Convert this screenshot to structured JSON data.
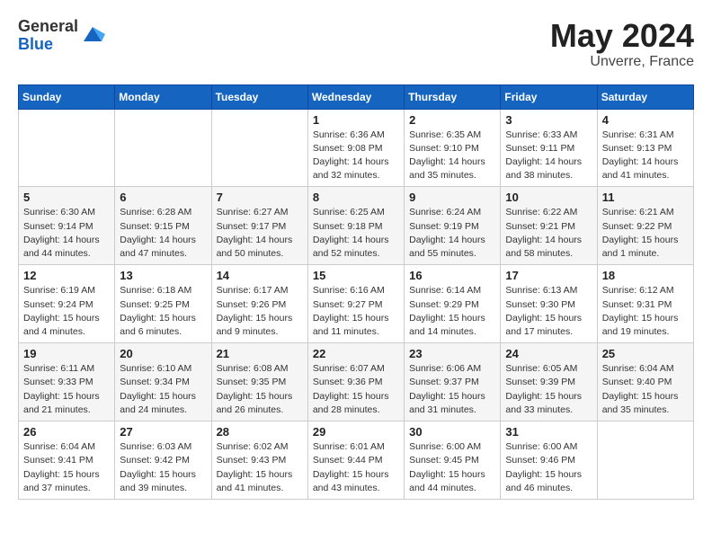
{
  "header": {
    "logo_general": "General",
    "logo_blue": "Blue",
    "month_year": "May 2024",
    "location": "Unverre, France"
  },
  "columns": [
    "Sunday",
    "Monday",
    "Tuesday",
    "Wednesday",
    "Thursday",
    "Friday",
    "Saturday"
  ],
  "weeks": [
    [
      {
        "day": "",
        "info": ""
      },
      {
        "day": "",
        "info": ""
      },
      {
        "day": "",
        "info": ""
      },
      {
        "day": "1",
        "info": "Sunrise: 6:36 AM\nSunset: 9:08 PM\nDaylight: 14 hours\nand 32 minutes."
      },
      {
        "day": "2",
        "info": "Sunrise: 6:35 AM\nSunset: 9:10 PM\nDaylight: 14 hours\nand 35 minutes."
      },
      {
        "day": "3",
        "info": "Sunrise: 6:33 AM\nSunset: 9:11 PM\nDaylight: 14 hours\nand 38 minutes."
      },
      {
        "day": "4",
        "info": "Sunrise: 6:31 AM\nSunset: 9:13 PM\nDaylight: 14 hours\nand 41 minutes."
      }
    ],
    [
      {
        "day": "5",
        "info": "Sunrise: 6:30 AM\nSunset: 9:14 PM\nDaylight: 14 hours\nand 44 minutes."
      },
      {
        "day": "6",
        "info": "Sunrise: 6:28 AM\nSunset: 9:15 PM\nDaylight: 14 hours\nand 47 minutes."
      },
      {
        "day": "7",
        "info": "Sunrise: 6:27 AM\nSunset: 9:17 PM\nDaylight: 14 hours\nand 50 minutes."
      },
      {
        "day": "8",
        "info": "Sunrise: 6:25 AM\nSunset: 9:18 PM\nDaylight: 14 hours\nand 52 minutes."
      },
      {
        "day": "9",
        "info": "Sunrise: 6:24 AM\nSunset: 9:19 PM\nDaylight: 14 hours\nand 55 minutes."
      },
      {
        "day": "10",
        "info": "Sunrise: 6:22 AM\nSunset: 9:21 PM\nDaylight: 14 hours\nand 58 minutes."
      },
      {
        "day": "11",
        "info": "Sunrise: 6:21 AM\nSunset: 9:22 PM\nDaylight: 15 hours\nand 1 minute."
      }
    ],
    [
      {
        "day": "12",
        "info": "Sunrise: 6:19 AM\nSunset: 9:24 PM\nDaylight: 15 hours\nand 4 minutes."
      },
      {
        "day": "13",
        "info": "Sunrise: 6:18 AM\nSunset: 9:25 PM\nDaylight: 15 hours\nand 6 minutes."
      },
      {
        "day": "14",
        "info": "Sunrise: 6:17 AM\nSunset: 9:26 PM\nDaylight: 15 hours\nand 9 minutes."
      },
      {
        "day": "15",
        "info": "Sunrise: 6:16 AM\nSunset: 9:27 PM\nDaylight: 15 hours\nand 11 minutes."
      },
      {
        "day": "16",
        "info": "Sunrise: 6:14 AM\nSunset: 9:29 PM\nDaylight: 15 hours\nand 14 minutes."
      },
      {
        "day": "17",
        "info": "Sunrise: 6:13 AM\nSunset: 9:30 PM\nDaylight: 15 hours\nand 17 minutes."
      },
      {
        "day": "18",
        "info": "Sunrise: 6:12 AM\nSunset: 9:31 PM\nDaylight: 15 hours\nand 19 minutes."
      }
    ],
    [
      {
        "day": "19",
        "info": "Sunrise: 6:11 AM\nSunset: 9:33 PM\nDaylight: 15 hours\nand 21 minutes."
      },
      {
        "day": "20",
        "info": "Sunrise: 6:10 AM\nSunset: 9:34 PM\nDaylight: 15 hours\nand 24 minutes."
      },
      {
        "day": "21",
        "info": "Sunrise: 6:08 AM\nSunset: 9:35 PM\nDaylight: 15 hours\nand 26 minutes."
      },
      {
        "day": "22",
        "info": "Sunrise: 6:07 AM\nSunset: 9:36 PM\nDaylight: 15 hours\nand 28 minutes."
      },
      {
        "day": "23",
        "info": "Sunrise: 6:06 AM\nSunset: 9:37 PM\nDaylight: 15 hours\nand 31 minutes."
      },
      {
        "day": "24",
        "info": "Sunrise: 6:05 AM\nSunset: 9:39 PM\nDaylight: 15 hours\nand 33 minutes."
      },
      {
        "day": "25",
        "info": "Sunrise: 6:04 AM\nSunset: 9:40 PM\nDaylight: 15 hours\nand 35 minutes."
      }
    ],
    [
      {
        "day": "26",
        "info": "Sunrise: 6:04 AM\nSunset: 9:41 PM\nDaylight: 15 hours\nand 37 minutes."
      },
      {
        "day": "27",
        "info": "Sunrise: 6:03 AM\nSunset: 9:42 PM\nDaylight: 15 hours\nand 39 minutes."
      },
      {
        "day": "28",
        "info": "Sunrise: 6:02 AM\nSunset: 9:43 PM\nDaylight: 15 hours\nand 41 minutes."
      },
      {
        "day": "29",
        "info": "Sunrise: 6:01 AM\nSunset: 9:44 PM\nDaylight: 15 hours\nand 43 minutes."
      },
      {
        "day": "30",
        "info": "Sunrise: 6:00 AM\nSunset: 9:45 PM\nDaylight: 15 hours\nand 44 minutes."
      },
      {
        "day": "31",
        "info": "Sunrise: 6:00 AM\nSunset: 9:46 PM\nDaylight: 15 hours\nand 46 minutes."
      },
      {
        "day": "",
        "info": ""
      }
    ]
  ]
}
